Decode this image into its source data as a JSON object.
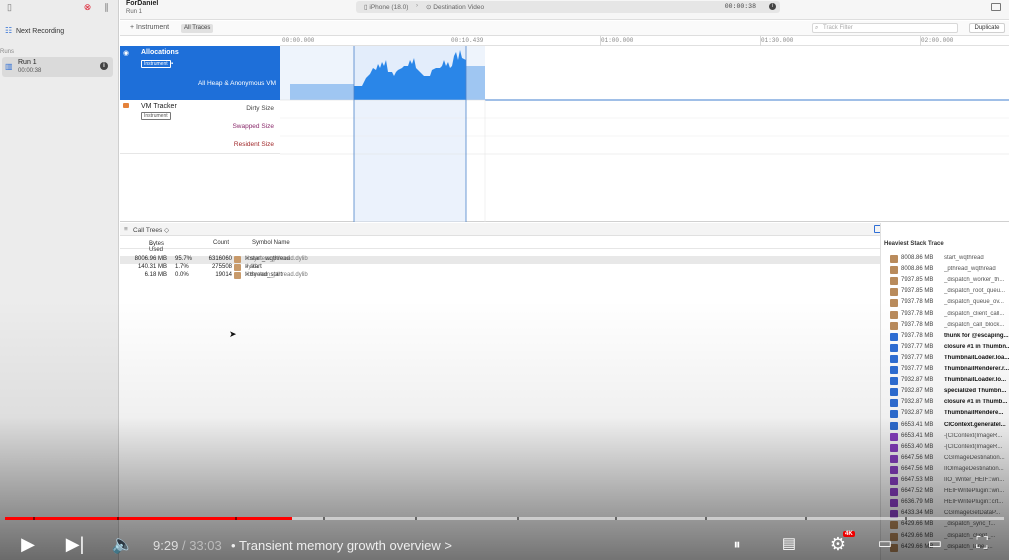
{
  "sidebar": {
    "next_recording": "Next Recording",
    "runs_label": "Runs",
    "run": {
      "name": "Run 1",
      "duration": "00:00:38"
    }
  },
  "toolbar": {
    "title": "ForDaniel",
    "subtitle": "Run 1",
    "device": "iPhone (18.0)",
    "process": "Destination Video",
    "elapsed": "00:00:38"
  },
  "filterbar": {
    "add_instrument": "+ Instrument",
    "all_traces": "All Traces",
    "track_filter_placeholder": "Track Filter",
    "duplicate": "Duplicate"
  },
  "ruler": {
    "ticks": [
      "00:00.000",
      "00:10.439",
      "01:00.000",
      "01:30.000",
      "02:00.000"
    ]
  },
  "tracks": {
    "allocations": {
      "name": "Allocations",
      "badge": "Instrument",
      "series": "All Heap & Anonymous VM"
    },
    "vm_tracker": {
      "name": "VM Tracker",
      "badge": "Instrument",
      "dirty": "Dirty Size",
      "swapped": "Swapped Size",
      "resident": "Resident Size"
    }
  },
  "detail": {
    "label": "Call Trees",
    "columns": {
      "bytes_used": "Bytes Used",
      "count": "Count",
      "symbol_name": "Symbol Name"
    },
    "rows": [
      {
        "bytes": "8006.96 MB",
        "pct": "95.7%",
        "count": "6316060",
        "symbol": "> start_wqthread",
        "lib": "libsystem_pthread.dylib"
      },
      {
        "bytes": "140.31 MB",
        "pct": "1.7%",
        "count": "275508",
        "symbol": "> start",
        "lib": "dyld"
      },
      {
        "bytes": "6.18 MB",
        "pct": "0.0%",
        "count": "19014",
        "symbol": "> thread_start",
        "lib": "libsystem_pthread.dylib"
      }
    ]
  },
  "heaviest": {
    "title": "Heaviest Stack Trace",
    "colors": {
      "system": "#b98b5c",
      "app": "#2f6fd6",
      "lib": "#8a3fc5"
    },
    "frames": [
      {
        "size": "8008.86 MB",
        "name": "start_wqthread",
        "kind": "system"
      },
      {
        "size": "8008.86 MB",
        "name": "_pthread_wqthread",
        "kind": "system"
      },
      {
        "size": "7937.85 MB",
        "name": "_dispatch_worker_th...",
        "kind": "system"
      },
      {
        "size": "7937.85 MB",
        "name": "_dispatch_root_queu...",
        "kind": "system"
      },
      {
        "size": "7937.78 MB",
        "name": "_dispatch_queue_ov...",
        "kind": "system"
      },
      {
        "size": "7937.78 MB",
        "name": "_dispatch_client_call...",
        "kind": "system"
      },
      {
        "size": "7937.78 MB",
        "name": "_dispatch_call_block...",
        "kind": "system"
      },
      {
        "size": "7937.78 MB",
        "name": "thunk for @escaping...",
        "kind": "app"
      },
      {
        "size": "7937.77 MB",
        "name": "closure #1 in Thumbn...",
        "kind": "app"
      },
      {
        "size": "7937.77 MB",
        "name": "ThumbnailLoader.loa...",
        "kind": "app"
      },
      {
        "size": "7937.77 MB",
        "name": "ThumbnailRenderer.r...",
        "kind": "app"
      },
      {
        "size": "7932.87 MB",
        "name": "ThumbnailLoader.lo...",
        "kind": "app"
      },
      {
        "size": "7932.87 MB",
        "name": "specialized Thumbn...",
        "kind": "app"
      },
      {
        "size": "7932.87 MB",
        "name": "closure #1 in Thumb...",
        "kind": "app"
      },
      {
        "size": "7932.87 MB",
        "name": "ThumbnailRendere...",
        "kind": "app"
      },
      {
        "size": "6653.41 MB",
        "name": "CIContext.generatel...",
        "kind": "app"
      },
      {
        "size": "6653.41 MB",
        "name": "-[CIContext(ImageR...",
        "kind": "lib"
      },
      {
        "size": "6653.40 MB",
        "name": "-[CIContext(ImageR...",
        "kind": "lib"
      },
      {
        "size": "6647.56 MB",
        "name": "CGImageDestination...",
        "kind": "lib"
      },
      {
        "size": "6647.56 MB",
        "name": "IIOImageDestination...",
        "kind": "lib"
      },
      {
        "size": "6647.53 MB",
        "name": "IIO_Writer_HEIF::wri...",
        "kind": "lib"
      },
      {
        "size": "6647.52 MB",
        "name": "HEIFWritePlugin::wri...",
        "kind": "lib"
      },
      {
        "size": "6636.79 MB",
        "name": "HEIFWritePlugin::crt...",
        "kind": "lib"
      },
      {
        "size": "6433.34 MB",
        "name": "CGImageGetDataP...",
        "kind": "lib"
      },
      {
        "size": "6429.66 MB",
        "name": "_dispatch_sync_f...",
        "kind": "system"
      },
      {
        "size": "6429.66 MB",
        "name": "_dispatch_client_...",
        "kind": "system"
      },
      {
        "size": "6429.66 MB",
        "name": "_dispatch_lane_...",
        "kind": "system"
      }
    ]
  },
  "player": {
    "current_time": "9:29",
    "total_time": "33:03",
    "separator": "/",
    "chapter_bullet": "•",
    "chapter": "Transient memory growth overview",
    "chapter_arrow": ">",
    "quality_badge": "4K",
    "progress_fraction": 0.287,
    "accent": "#ff0000"
  }
}
